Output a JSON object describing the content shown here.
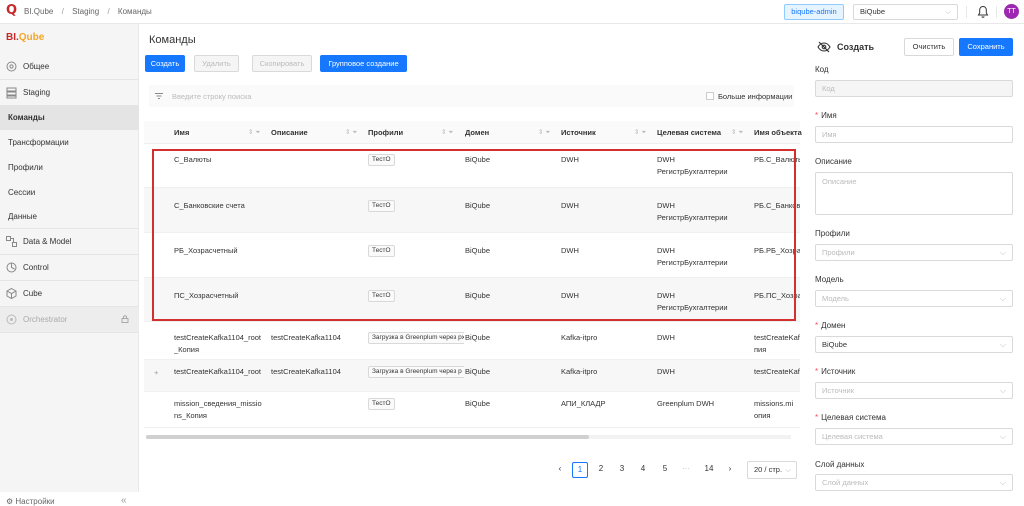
{
  "topbar": {
    "breadcrumbs": [
      "BI.Qube",
      "Staging",
      "Команды"
    ],
    "separator": "/",
    "env_tag": "biqube-admin",
    "domain_select": "BiQube",
    "avatar_initials": "TT",
    "accent": "#1677ff"
  },
  "sidebar": {
    "brand_a": "BI.",
    "brand_b": "Qube",
    "items": [
      {
        "label": "Общее",
        "icon": "general-icon"
      },
      {
        "label": "Staging",
        "icon": "staging-icon"
      },
      {
        "label": "Команды"
      },
      {
        "label": "Трансформации"
      },
      {
        "label": "Профили"
      },
      {
        "label": "Сессии"
      },
      {
        "label": "Данные"
      },
      {
        "label": "Data & Model",
        "icon": "data-model-icon"
      },
      {
        "label": "Control",
        "icon": "control-icon"
      },
      {
        "label": "Cube",
        "icon": "cube-icon"
      },
      {
        "label": "Orchestrator",
        "icon": "orchestrator-icon"
      }
    ],
    "settings": "Настройки",
    "collapse": "«"
  },
  "main": {
    "title": "Команды",
    "buttons": {
      "create": "Создать",
      "delete": "Удалить",
      "copy": "Скопировать",
      "group_create": "Групповое создание"
    },
    "search_placeholder": "Введите строку поиска",
    "more_info": "Больше информации",
    "columns": [
      "Имя",
      "Описание",
      "Профили",
      "Домен",
      "Источник",
      "Целевая система",
      "Имя объекта"
    ],
    "rows": [
      {
        "name": [
          "С_Валюты"
        ],
        "desc": "",
        "profile": "ТестО",
        "domain": "BiQube",
        "source": "DWH",
        "target": [
          "DWH",
          "РегистрБухгалтерии"
        ],
        "object": [
          "РБ.С_Валюты"
        ]
      },
      {
        "name": [
          "С_Банковские счета"
        ],
        "desc": "",
        "profile": "ТестО",
        "domain": "BiQube",
        "source": "DWH",
        "target": [
          "DWH",
          "РегистрБухгалтерии"
        ],
        "object": [
          "РБ.С_Банковские"
        ]
      },
      {
        "name": [
          "РБ_Хозрасчетный"
        ],
        "desc": "",
        "profile": "ТестО",
        "domain": "BiQube",
        "source": "DWH",
        "target": [
          "DWH",
          "РегистрБухгалтерии"
        ],
        "object": [
          "РБ.РБ_Хозрасчетный"
        ]
      },
      {
        "name": [
          "ПС_Хозрасчетный"
        ],
        "desc": "",
        "profile": "ТестО",
        "domain": "BiQube",
        "source": "DWH",
        "target": [
          "DWH",
          "РегистрБухгалтерии"
        ],
        "object": [
          "РБ.ПС_Хозрасчетный"
        ]
      },
      {
        "name": [
          "testCreateKafka1104_root",
          "_Копия"
        ],
        "desc": "testCreateKafka1104",
        "profile": "Загрузка в Greenplum через px",
        "domain": "BiQube",
        "source": "Kafka-itpro",
        "target": [
          "DWH"
        ],
        "object": [
          "testCreateKafka",
          "пия"
        ]
      },
      {
        "name": [
          "testCreateKafka1104_root"
        ],
        "desc": "testCreateKafka1104",
        "profile": "Загрузка в Greenplum через p",
        "domain": "BiQube",
        "source": "Kafka-itpro",
        "target": [
          "DWH"
        ],
        "object": [
          "testCreateKafka"
        ]
      },
      {
        "name": [
          "mission_сведения_missio",
          "ns_Копия"
        ],
        "desc": "",
        "profile": "ТестО",
        "domain": "BiQube",
        "source": "АПИ_КЛАДР",
        "target": [
          "Greenplum DWH"
        ],
        "object": [
          "missions.mi",
          "опия"
        ]
      }
    ],
    "expand_symbol": "+",
    "highlight_color": "#d32f2f",
    "pagination": {
      "prev": "‹",
      "pages": [
        "1",
        "2",
        "3",
        "4",
        "5"
      ],
      "ellipsis": "···",
      "last": "14",
      "next": "›",
      "current": "1",
      "page_size": "20 / стр."
    }
  },
  "panel": {
    "title": "Создать",
    "clear": "Очистить",
    "save": "Сохранить",
    "fields": [
      {
        "label": "Код",
        "required": false,
        "placeholder": "Код",
        "type": "disabled"
      },
      {
        "label": "Имя",
        "required": true,
        "placeholder": "Имя",
        "type": "text"
      },
      {
        "label": "Описание",
        "required": false,
        "placeholder": "Описание",
        "type": "textarea"
      },
      {
        "label": "Профили",
        "required": false,
        "placeholder": "Профили",
        "type": "select"
      },
      {
        "label": "Модель",
        "required": false,
        "placeholder": "Модель",
        "type": "select"
      },
      {
        "label": "Домен",
        "required": true,
        "value": "BiQube",
        "type": "select"
      },
      {
        "label": "Источник",
        "required": true,
        "placeholder": "Источник",
        "type": "select"
      },
      {
        "label": "Целевая система",
        "required": true,
        "placeholder": "Целевая система",
        "type": "select"
      },
      {
        "label": "Слой данных",
        "required": false,
        "placeholder": "Слой данных",
        "type": "select"
      }
    ],
    "req_mark": "*"
  }
}
